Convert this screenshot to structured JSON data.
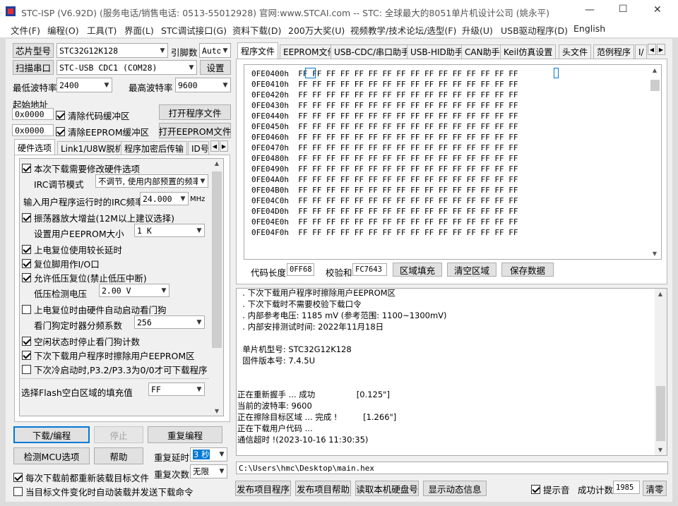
{
  "window": {
    "title": "STC-ISP (V6.92D) (服务电话/销售电话: 0513-55012928) 官网:www.STCAI.com  -- STC: 全球最大的8051单片机设计公司 (姚永平)",
    "controls": {
      "minimize": "—",
      "maximize": "☐",
      "close": "✕"
    }
  },
  "menu": [
    "文件(F)",
    "编程(O)",
    "工具(T)",
    "界面(L)",
    "STC调试接口(G)",
    "资料下载(D)",
    "200万大奖(U)",
    "视频教学/技术论坛/选型(F)",
    "升级(U)",
    "USB驱动程序(D)",
    "English"
  ],
  "left": {
    "chip_model_btn": "芯片型号",
    "chip_model": "STC32G12K128",
    "pin_count_label": "引脚数",
    "pin_count": "Auto",
    "scan_port_btn": "扫描串口",
    "port": "STC-USB CDC1 (COM28)",
    "settings_btn": "设置",
    "min_baud_label": "最低波特率",
    "min_baud": "2400",
    "max_baud_label": "最高波特率",
    "max_baud": "9600",
    "start_addr_label": "起始地址",
    "addr1": "0x0000",
    "clear_code_buf": "清除代码缓冲区",
    "open_prog_btn": "打开程序文件",
    "addr2": "0x0000",
    "clear_eeprom_buf": "清除EEPROM缓冲区",
    "open_eeprom_btn": "打开EEPROM文件",
    "tabs": [
      "硬件选项",
      "Link1/U8W脱机",
      "程序加密后传输",
      "ID号"
    ],
    "options": {
      "modify_hw": "本次下载需要修改硬件选项",
      "irc_mode_label": "IRC调节模式",
      "irc_mode": "不调节, 使用内部预置的频率",
      "irc_freq_label": "输入用户程序运行时的IRC频率",
      "irc_freq": "24.000",
      "mhz": "MHz",
      "osc_gain": "振荡器放大增益(12M以上建议选择)",
      "eeprom_size_label": "设置用户EEPROM大小",
      "eeprom_size": "1   K",
      "long_delay": "上电复位使用较长延时",
      "reset_pin_io": "复位脚用作I/O口",
      "lvd_reset": "允许低压复位(禁止低压中断)",
      "lvd_voltage_label": "低压检测电压",
      "lvd_voltage": "2.00 V",
      "wdt_hw": "上电复位时由硬件自动启动看门狗",
      "wdt_div_label": "看门狗定时器分频系数",
      "wdt_div": "256",
      "idle_wdt": "空闲状态时停止看门狗计数",
      "erase_eeprom": "下次下载用户程序时擦除用户EEPROM区",
      "cold_boot": "下次冷启动时,P3.2/P3.3为0/0才可下载程序",
      "flash_fill_label": "选择Flash空白区域的填充值",
      "flash_fill": "FF"
    },
    "download_btn": "下载/编程",
    "stop_btn": "停止",
    "repeat_prog_btn": "重复编程",
    "detect_mcu_btn": "检测MCU选项",
    "help_btn": "帮助",
    "repeat_delay_label": "重复延时",
    "repeat_delay": "3 秒",
    "repeat_count_label": "重复次数",
    "repeat_count": "无限",
    "reload_each": "每次下载前都重新装载目标文件",
    "auto_send": "当目标文件变化时自动装载并发送下载命令"
  },
  "right": {
    "tabs": [
      "程序文件",
      "EEPROM文件",
      "USB-CDC/串口助手",
      "USB-HID助手",
      "CAN助手",
      "Keil仿真设置",
      "头文件",
      "范例程序",
      "I/"
    ],
    "hex_rows": [
      {
        "addr": "0FE0400h",
        "bytes": "FF FF FF FF FF FF FF FF FF FF FF FF FF FF FF FF"
      },
      {
        "addr": "0FE0410h",
        "bytes": "FF FF FF FF FF FF FF FF FF FF FF FF FF FF FF FF"
      },
      {
        "addr": "0FE0420h",
        "bytes": "FF FF FF FF FF FF FF FF FF FF FF FF FF FF FF FF"
      },
      {
        "addr": "0FE0430h",
        "bytes": "FF FF FF FF FF FF FF FF FF FF FF FF FF FF FF FF"
      },
      {
        "addr": "0FE0440h",
        "bytes": "FF FF FF FF FF FF FF FF FF FF FF FF FF FF FF FF"
      },
      {
        "addr": "0FE0450h",
        "bytes": "FF FF FF FF FF FF FF FF FF FF FF FF FF FF FF FF"
      },
      {
        "addr": "0FE0460h",
        "bytes": "FF FF FF FF FF FF FF FF FF FF FF FF FF FF FF FF"
      },
      {
        "addr": "0FE0470h",
        "bytes": "FF FF FF FF FF FF FF FF FF FF FF FF FF FF FF FF"
      },
      {
        "addr": "0FE0480h",
        "bytes": "FF FF FF FF FF FF FF FF FF FF FF FF FF FF FF FF"
      },
      {
        "addr": "0FE0490h",
        "bytes": "FF FF FF FF FF FF FF FF FF FF FF FF FF FF FF FF"
      },
      {
        "addr": "0FE04A0h",
        "bytes": "FF FF FF FF FF FF FF FF FF FF FF FF FF FF FF FF"
      },
      {
        "addr": "0FE04B0h",
        "bytes": "FF FF FF FF FF FF FF FF FF FF FF FF FF FF FF FF"
      },
      {
        "addr": "0FE04C0h",
        "bytes": "FF FF FF FF FF FF FF FF FF FF FF FF FF FF FF FF"
      },
      {
        "addr": "0FE04D0h",
        "bytes": "FF FF FF FF FF FF FF FF FF FF FF FF FF FF FF FF"
      },
      {
        "addr": "0FE04E0h",
        "bytes": "FF FF FF FF FF FF FF FF FF FF FF FF FF FF FF FF"
      },
      {
        "addr": "0FE04F0h",
        "bytes": "FF FF FF FF FF FF FF FF FF FF FF FF FF FF FF FF"
      }
    ],
    "code_len_label": "代码长度",
    "code_len": "0FF68",
    "checksum_label": "校验和",
    "checksum": "FC7643",
    "fill_btn": "区域填充",
    "clear_btn": "清空区域",
    "save_btn": "保存数据",
    "log": [
      "  . 下次下载用户程序时擦除用户EEPROM区",
      "  . 下次下载时不需要校验下载口令",
      "  . 内部参考电压: 1185 mV (参考范围: 1100~1300mV)",
      "  . 内部安排测试时间: 2022年11月18日",
      "",
      "  单片机型号: STC32G12K128",
      "  固件版本号: 7.4.5U",
      "",
      "",
      "正在重新握手 ... 成功                [0.125\"]",
      "当前的波特率: 9600",
      "正在擦除目标区域 ... 完成 !          [1.266\"]",
      "正在下载用户代码 ...",
      "通信超时 !(2023-10-16 11:30:35)"
    ],
    "path": "C:\\Users\\hmc\\Desktop\\main.hex",
    "publish_prog_btn": "发布项目程序",
    "publish_help_btn": "发布项目帮助",
    "read_disk_btn": "读取本机硬盘号",
    "show_anim_btn": "显示动态信息",
    "beep_label": "提示音",
    "success_count_label": "成功计数",
    "success_count": "1985",
    "clear_count_btn": "清零"
  }
}
